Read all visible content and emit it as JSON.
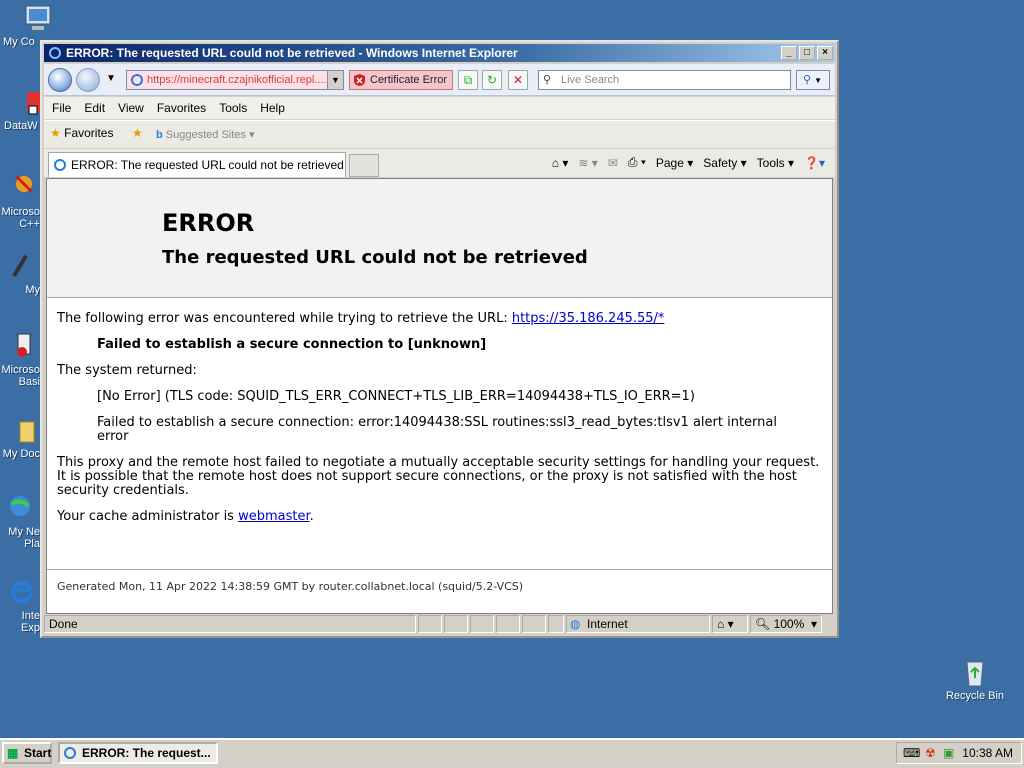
{
  "window": {
    "title": "ERROR: The requested URL could not be retrieved - Windows Internet Explorer"
  },
  "navbar": {
    "address": "https://minecraft.czajnikofficial.repl....",
    "cert_error": "Certificate Error",
    "search_placeholder": "Live Search"
  },
  "menu": [
    "File",
    "Edit",
    "View",
    "Favorites",
    "Tools",
    "Help"
  ],
  "favbar": {
    "favorites": "Favorites",
    "suggested": "Suggested Sites"
  },
  "tab": {
    "title": "ERROR: The requested URL could not be retrieved"
  },
  "cmdbar": {
    "page": "Page",
    "safety": "Safety",
    "tools": "Tools"
  },
  "page": {
    "heading": "ERROR",
    "subheading": "The requested URL could not be retrieved",
    "intro": "The following error was encountered while trying to retrieve the URL:",
    "url_link": "https://35.186.245.55/*",
    "failure": "Failed to establish a secure connection to [unknown]",
    "system_returned": "The system returned:",
    "tls_code": "[No Error] (TLS code: SQUID_TLS_ERR_CONNECT+TLS_LIB_ERR=14094438+TLS_IO_ERR=1)",
    "secure_error": "Failed to establish a secure connection: error:14094438:SSL routines:ssl3_read_bytes:tlsv1 alert internal error",
    "explanation": "This proxy and the remote host failed to negotiate a mutually acceptable security settings for handling your request. It is possible that the remote host does not support secure connections, or the proxy is not satisfied with the host security credentials.",
    "admin_prefix": "Your cache administrator is",
    "admin_link": "webmaster",
    "admin_suffix": ".",
    "footer": "Generated Mon, 11 Apr 2022 14:38:59 GMT by router.collabnet.local (squid/5.2-VCS)"
  },
  "status": {
    "text": "Done",
    "zone": "Internet",
    "zoom": "100%"
  },
  "taskbar": {
    "start": "Start",
    "task": "ERROR: The request...",
    "clock": "10:38 AM"
  },
  "desktop": {
    "icons": [
      "My Co",
      "DataW",
      "Microso C++",
      "My",
      "Microso Basi",
      "My Doc",
      "My Ne Pla",
      "Inte Exp",
      "Recycle Bin"
    ]
  }
}
